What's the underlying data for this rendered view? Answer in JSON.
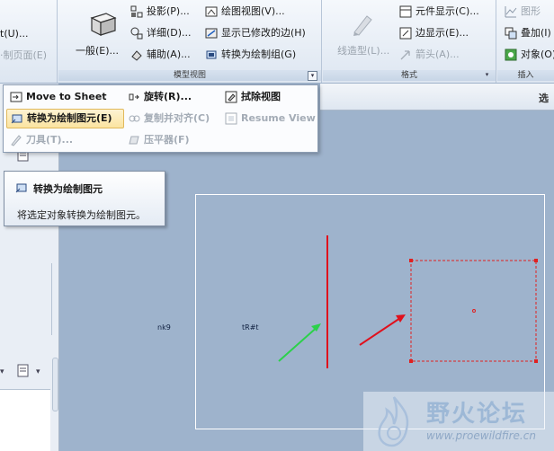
{
  "ribbon": {
    "left_group": {
      "item1": "t(U)...",
      "item2": "·制页面(E)"
    },
    "model_views": {
      "label": "模型视图",
      "general": "一般(E)...",
      "projection": "投影(P)...",
      "detailed": "详细(D)...",
      "auxiliary": "辅助(A)...",
      "drawing_view": "绘图视图(V)...",
      "show_modified_edges": "显示已修改的边(H)",
      "convert_to_draw_group": "转换为绘制组(G)"
    },
    "format": {
      "label": "格式",
      "line_style": "线造型(L)...",
      "element_display": "元件显示(C)...",
      "edge_display": "边显示(E)...",
      "arrow": "箭头(A)..."
    },
    "insert": {
      "label": "插入",
      "graphics": "图形",
      "overlay": "叠加(I)",
      "object": "对象(O)"
    }
  },
  "menu": {
    "move_to_sheet": "Move to Sheet",
    "rotate": "旋转(R)...",
    "erase_view": "拭除视图",
    "convert_to_draw_element": "转换为绘制图元(E)",
    "copy_and_align": "复制并对齐(C)",
    "resume_view": "Resume View",
    "knife": "刀具(T)...",
    "flatten": "压平器(F)"
  },
  "tooltip": {
    "title": "转换为绘制图元",
    "description": "将选定对象转换为绘制图元。"
  },
  "canvas": {
    "label_left": "nk9",
    "label_right": "tR#t"
  },
  "watermark": {
    "title": "野火论坛",
    "url": "www.proewildfire.cn"
  },
  "colors": {
    "canvas_bg": "#9eb3cc",
    "red_line": "#e0101c",
    "green_arrow": "#2bd14a",
    "selection": "#e02020"
  }
}
